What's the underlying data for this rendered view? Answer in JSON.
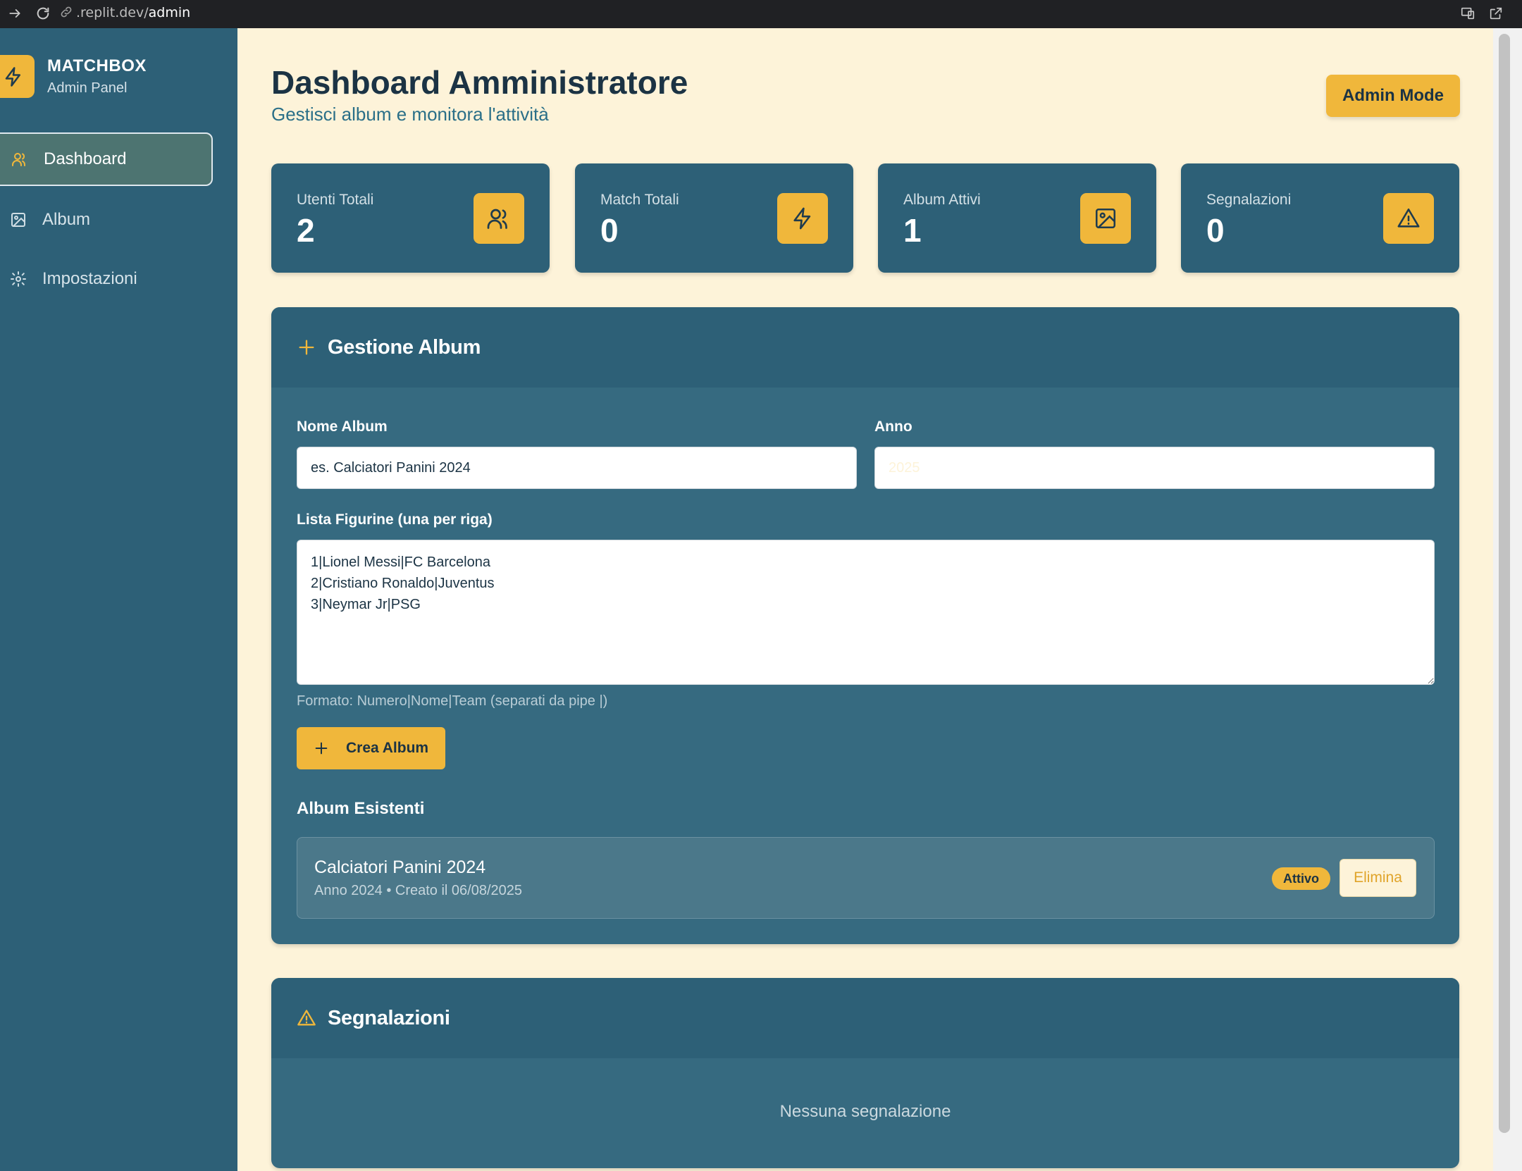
{
  "browser": {
    "url_host": ".replit.dev/",
    "url_path": "admin"
  },
  "sidebar": {
    "brand_title": "MATCHBOX",
    "brand_subtitle": "Admin Panel",
    "items": [
      {
        "label": "Dashboard",
        "icon": "users-icon",
        "active": true
      },
      {
        "label": "Album",
        "icon": "image-icon",
        "active": false
      },
      {
        "label": "Impostazioni",
        "icon": "gear-icon",
        "active": false
      }
    ]
  },
  "header": {
    "title": "Dashboard Amministratore",
    "subtitle": "Gestisci album e monitora l'attività",
    "admin_button": "Admin Mode"
  },
  "stats": [
    {
      "label": "Utenti Totali",
      "value": "2",
      "icon": "users-icon"
    },
    {
      "label": "Match Totali",
      "value": "0",
      "icon": "lightning-icon"
    },
    {
      "label": "Album Attivi",
      "value": "1",
      "icon": "image-icon"
    },
    {
      "label": "Segnalazioni",
      "value": "0",
      "icon": "warning-icon"
    }
  ],
  "album_panel": {
    "title": "Gestione Album",
    "name_label": "Nome Album",
    "name_value": "es. Calciatori Panini 2024",
    "year_label": "Anno",
    "year_placeholder": "2025",
    "list_label": "Lista Figurine (una per riga)",
    "list_value": "1|Lionel Messi|FC Barcelona\n2|Cristiano Ronaldo|Juventus\n3|Neymar Jr|PSG",
    "hint": "Formato: Numero|Nome|Team (separati da pipe |)",
    "create_button": "Crea Album",
    "existing_title": "Album Esistenti",
    "albums": [
      {
        "name": "Calciatori Panini 2024",
        "meta": "Anno 2024 • Creato il 06/08/2025",
        "status": "Attivo",
        "delete_label": "Elimina"
      }
    ]
  },
  "reports_panel": {
    "title": "Segnalazioni",
    "empty_text": "Nessuna segnalazione"
  },
  "colors": {
    "accent": "#f0b73b",
    "sidebar": "#2d6077",
    "panel": "#366a80",
    "background": "#fdf3d9"
  }
}
